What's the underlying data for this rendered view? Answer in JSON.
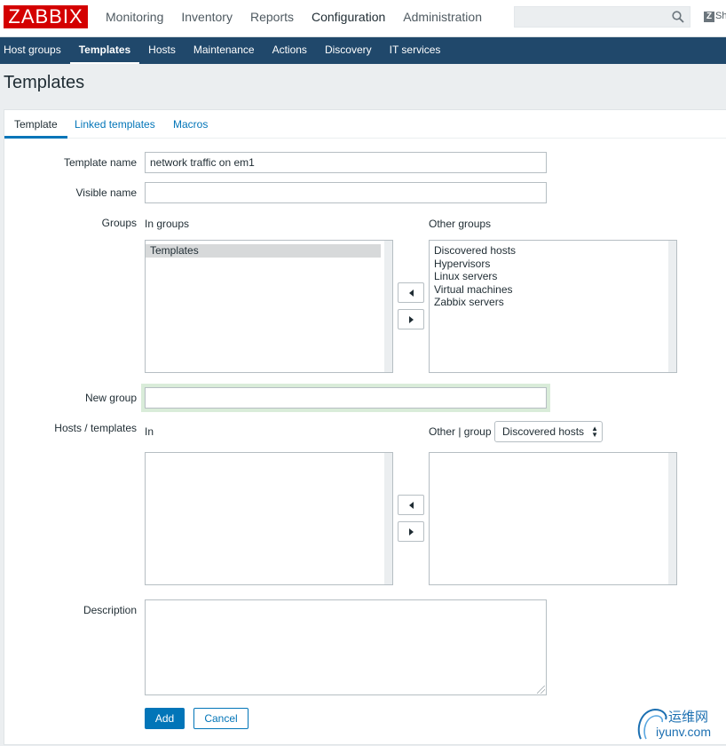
{
  "logo": "ZABBIX",
  "top_menu": [
    "Monitoring",
    "Inventory",
    "Reports",
    "Configuration",
    "Administration"
  ],
  "top_menu_active": "Configuration",
  "search": {
    "value": "",
    "placeholder": ""
  },
  "share_label": "Sh",
  "sub_menu": [
    "Host groups",
    "Templates",
    "Hosts",
    "Maintenance",
    "Actions",
    "Discovery",
    "IT services"
  ],
  "sub_menu_active": "Templates",
  "page_title": "Templates",
  "tabs": [
    "Template",
    "Linked templates",
    "Macros"
  ],
  "active_tab": "Template",
  "form": {
    "template_name_label": "Template name",
    "template_name_value": "network traffic on em1",
    "visible_name_label": "Visible name",
    "visible_name_value": "",
    "groups_label": "Groups",
    "in_groups_label": "In groups",
    "in_groups": [
      "Templates"
    ],
    "other_groups_label": "Other groups",
    "other_groups": [
      "Discovered hosts",
      "Hypervisors",
      "Linux servers",
      "Virtual machines",
      "Zabbix servers"
    ],
    "new_group_label": "New group",
    "new_group_value": "",
    "hosts_templates_label": "Hosts / templates",
    "in_label": "In",
    "other_group_label": "Other | group",
    "other_group_select": "Discovered hosts",
    "description_label": "Description",
    "description_value": "",
    "add_button": "Add",
    "cancel_button": "Cancel"
  },
  "watermark": {
    "cn": "运维网",
    "url": "iyunv.com"
  },
  "colors": {
    "brand_red": "#d40000",
    "nav_blue": "#20486b",
    "link_blue": "#0275b8"
  }
}
